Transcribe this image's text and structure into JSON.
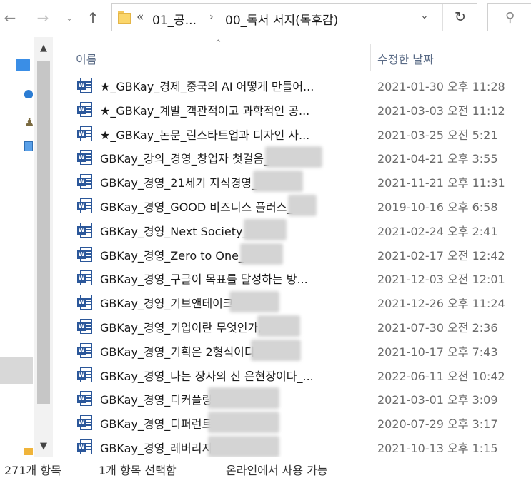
{
  "nav": {
    "back_glyph": "←",
    "forward_glyph": "→",
    "recent_glyph": "⌄",
    "up_glyph": "↑"
  },
  "address": {
    "overflow": "«",
    "crumb1": "01_공...",
    "separator": "›",
    "crumb2": "00_독서 서지(독후감)",
    "dropdown_glyph": "⌄",
    "refresh_glyph": "↻"
  },
  "search": {
    "icon": "search-icon",
    "glyph": "⚲"
  },
  "columns": {
    "name": "이름",
    "date": "수정한 날짜",
    "sort_glyph": "⌃"
  },
  "files": [
    {
      "name": "★_GBKay_경제_중국의 AI 어떻게 만들어...",
      "date": "2021-01-30 오후 11:28",
      "redact": 0
    },
    {
      "name": "★_GBKay_계발_객관적이고 과학적인 공...",
      "date": "2021-03-03 오전 11:12",
      "redact": 0
    },
    {
      "name": "★_GBKay_논문_린스타트업과 디자인 사...",
      "date": "2021-03-25 오전 5:21",
      "redact": 0
    },
    {
      "name": "GBKay_강의_경영_창업자 첫걸음_",
      "date": "2021-04-21 오후 3:55",
      "redact": 80
    },
    {
      "name": "GBKay_경영_21세기 지식경영_",
      "date": "2021-11-21 오후 11:31",
      "redact": 70
    },
    {
      "name": "GBKay_경영_GOOD 비즈니스 플러스_",
      "date": "2019-10-16 오후 6:58",
      "redact": 40
    },
    {
      "name": "GBKay_경영_Next Society_",
      "date": "2021-02-24 오후 2:41",
      "redact": 60
    },
    {
      "name": "GBKay_경영_Zero to One_",
      "date": "2021-02-17 오전 12:42",
      "redact": 60
    },
    {
      "name": "GBKay_경영_구글이 목표를 달성하는 방...",
      "date": "2021-12-03 오전 12:01",
      "redact": 0
    },
    {
      "name": "GBKay_경영_기브앤테이크",
      "date": "2021-12-26 오후 11:24",
      "redact": 70
    },
    {
      "name": "GBKay_경영_기업이란 무엇인가,",
      "date": "2021-07-30 오전 2:36",
      "redact": 60
    },
    {
      "name": "GBKay_경영_기획은 2형식이디",
      "date": "2021-10-17 오후 7:43",
      "redact": 70
    },
    {
      "name": "GBKay_경영_나는 장사의 신 은현장이다_...",
      "date": "2022-06-11 오전 10:42",
      "redact": 0
    },
    {
      "name": "GBKay_경영_디커플링",
      "date": "2021-03-01 오후 3:09",
      "redact": 100
    },
    {
      "name": "GBKay_경영_디퍼런트",
      "date": "2020-07-29 오후 3:17",
      "redact": 100
    },
    {
      "name": "GBKay_경영_레버리지",
      "date": "2021-10-13 오후 1:15",
      "redact": 100
    }
  ],
  "status": {
    "count": "271개 항목",
    "selected": "1개 항목 선택함",
    "availability": "온라인에서 사용 가능"
  },
  "navpane": {
    "scroll_up": "▲",
    "scroll_down": "▼"
  }
}
